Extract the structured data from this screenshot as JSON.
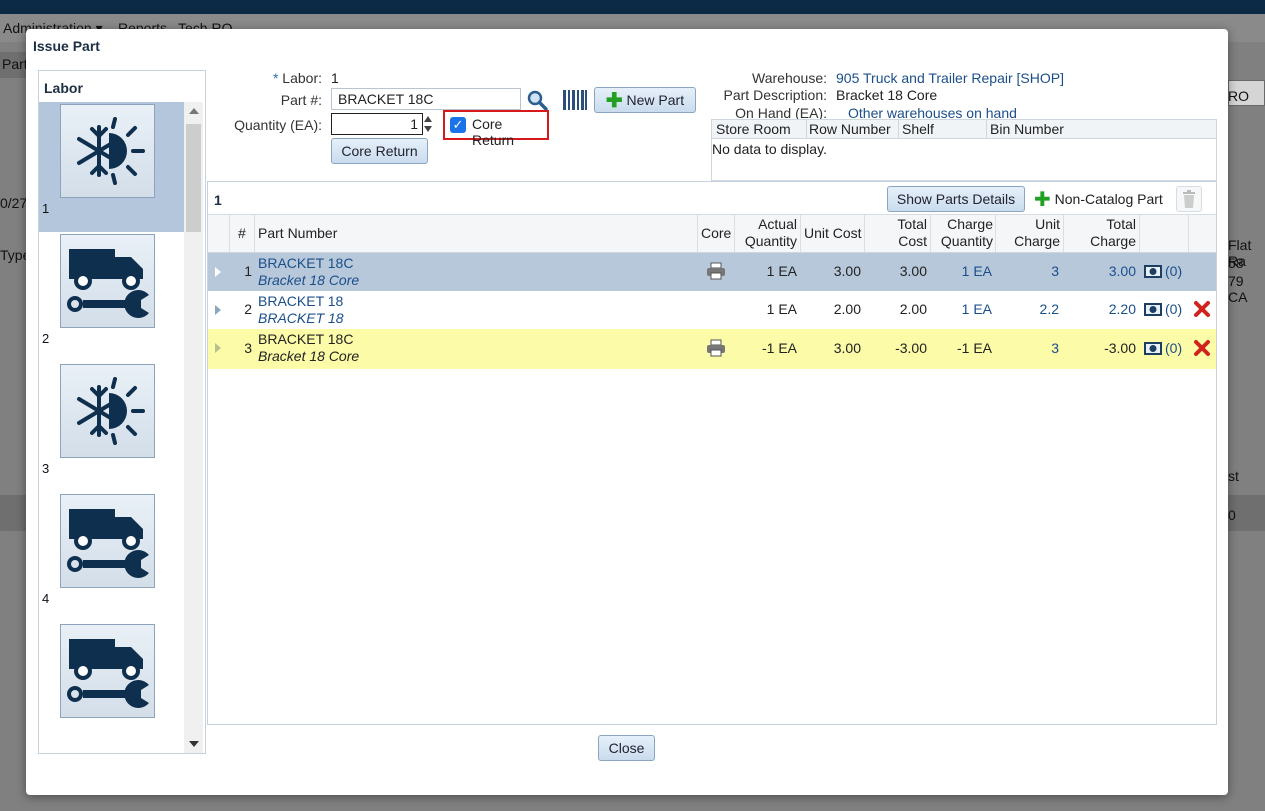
{
  "background": {
    "menu": [
      "Administration ▾",
      "Reports",
      "Tech RO"
    ],
    "side_fragments": [
      "Part",
      "0/27/",
      "Type",
      "RO",
      "Flat Ra",
      "58",
      "79 CA",
      "st",
      "0"
    ]
  },
  "dialog": {
    "title": "Issue Part",
    "labor_header": "Labor",
    "labor_items": [
      "1",
      "2",
      "3",
      "4",
      ""
    ],
    "form": {
      "labor_label": "Labor:",
      "labor_required_mark": "*",
      "labor_value": "1",
      "part_label": "Part #:",
      "part_value": "BRACKET 18C",
      "qty_label": "Quantity (EA):",
      "qty_value": "1",
      "core_return_checkbox_label": "Core Return",
      "core_return_button": "Core Return",
      "new_part_button": "New Part",
      "warehouse_label": "Warehouse:",
      "warehouse_value": "905 Truck and Trailer Repair [SHOP]",
      "part_desc_label": "Part Description:",
      "part_desc_value": "Bracket 18 Core",
      "on_hand_label": "On Hand (EA):",
      "on_hand_link": "Other warehouses on hand"
    },
    "store_table": {
      "columns": [
        "Store Room",
        "Row Number",
        "Shelf",
        "Bin Number"
      ],
      "empty": "No data to display."
    },
    "parts_grid": {
      "count": "1",
      "show_details_button": "Show Parts Details",
      "non_catalog_button": "Non-Catalog Part",
      "columns": {
        "num": "#",
        "part_number": "Part Number",
        "core": "Core",
        "actual_qty_1": "Actual",
        "actual_qty_2": "Quantity",
        "unit_cost": "Unit Cost",
        "total_cost_1": "Total",
        "total_cost_2": "Cost",
        "charge_qty_1": "Charge",
        "charge_qty_2": "Quantity",
        "unit_charge_1": "Unit",
        "unit_charge_2": "Charge",
        "total_charge_1": "Total",
        "total_charge_2": "Charge"
      },
      "rows": [
        {
          "num": "1",
          "part": "BRACKET 18C",
          "desc": "Bracket 18 Core",
          "actual_qty": "1 EA",
          "unit_cost": "3.00",
          "total_cost": "3.00",
          "charge_qty": "1 EA",
          "unit_charge": "3",
          "total_charge": "3.00",
          "photos": "(0)"
        },
        {
          "num": "2",
          "part": "BRACKET 18",
          "desc": "BRACKET 18",
          "actual_qty": "1 EA",
          "unit_cost": "2.00",
          "total_cost": "2.00",
          "charge_qty": "1 EA",
          "unit_charge": "2.2",
          "total_charge": "2.20",
          "photos": "(0)"
        },
        {
          "num": "3",
          "part": "BRACKET 18C",
          "desc": "Bracket 18 Core",
          "actual_qty": "-1 EA",
          "unit_cost": "3.00",
          "total_cost": "-3.00",
          "charge_qty": "-1 EA",
          "unit_charge": "3",
          "total_charge": "-3.00",
          "photos": "(0)"
        }
      ]
    },
    "close_button": "Close"
  }
}
